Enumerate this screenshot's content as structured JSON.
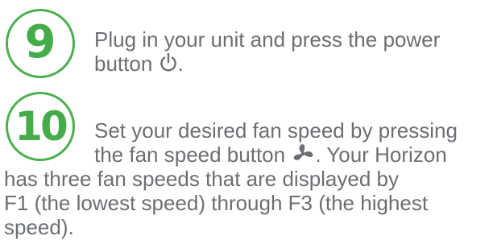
{
  "steps": [
    {
      "number": "9",
      "lines": [
        "Plug in your unit and press the power",
        "button",
        "."
      ],
      "icons": [
        "power-icon"
      ]
    },
    {
      "number": "10",
      "lines": [
        "Set your desired fan speed by pressing",
        "the fan speed button",
        ".  Your Horizon",
        "has three fan speeds that are displayed by",
        "F1 (the lowest speed) through F3 (the highest",
        "speed)."
      ],
      "icons": [
        "fan-icon"
      ]
    }
  ],
  "colors": {
    "accent_green": "#44ad4a",
    "badge_border": "#4caf50",
    "text_gray": "#6b6f73"
  }
}
